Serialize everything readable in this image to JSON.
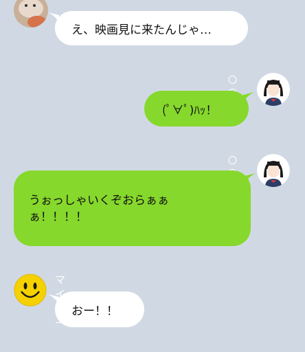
{
  "messages": [
    {
      "side": "left",
      "sender": "",
      "avatar": "hamster-photo",
      "text": "え、映画見に来たんじゃ…"
    },
    {
      "side": "right",
      "read": "〇〇",
      "avatar": "schoolgirl-avatar",
      "text": "(ﾟ∀ﾟ)ﾊｯ！"
    },
    {
      "side": "right",
      "read": "〇〇",
      "avatar": "schoolgirl-avatar",
      "text": "うぉっしゃいくぞおらぁぁ\nぁ！！！！"
    },
    {
      "side": "left",
      "sender": "マイキー",
      "avatar": "smiley-face",
      "text": "おー！！"
    }
  ],
  "colors": {
    "background": "#d0d9e3",
    "incoming_bubble": "#ffffff",
    "outgoing_bubble": "#86d82c"
  }
}
